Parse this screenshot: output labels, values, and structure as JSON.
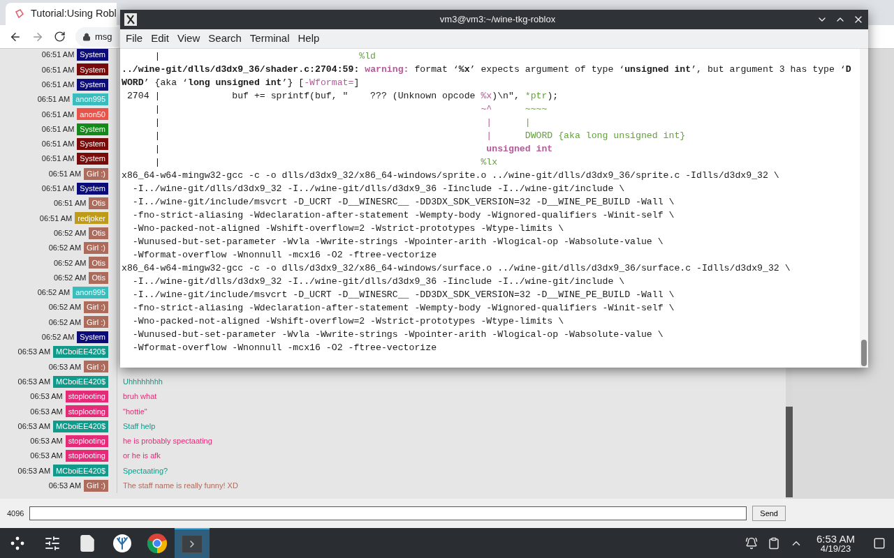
{
  "browser": {
    "tabs": [
      {
        "title": "Tutorial:Using Robl",
        "selected": true
      }
    ],
    "address": "msg"
  },
  "chat": {
    "rows": [
      {
        "time": "06:51 AM",
        "name": "System",
        "color": "#0b0b7a"
      },
      {
        "time": "06:51 AM",
        "name": "System",
        "color": "#7a0b0b"
      },
      {
        "time": "06:51 AM",
        "name": "System",
        "color": "#0b0b7a"
      },
      {
        "time": "06:51 AM",
        "name": "anon995",
        "color": "#3bbdbd"
      },
      {
        "time": "06:51 AM",
        "name": "anon50",
        "color": "#e8534a"
      },
      {
        "time": "06:51 AM",
        "name": "System",
        "color": "#138a1a"
      },
      {
        "time": "06:51 AM",
        "name": "System",
        "color": "#7a0b0b"
      },
      {
        "time": "06:51 AM",
        "name": "System",
        "color": "#7a0b0b"
      },
      {
        "time": "06:51 AM",
        "name": "Girl :)",
        "color": "#ad6b5c"
      },
      {
        "time": "06:51 AM",
        "name": "System",
        "color": "#0b0b7a"
      },
      {
        "time": "06:51 AM",
        "name": "Otis",
        "color": "#ad6b5c"
      },
      {
        "time": "06:51 AM",
        "name": "redjoker",
        "color": "#bf9b1c"
      },
      {
        "time": "06:52 AM",
        "name": "Otis",
        "color": "#ad6b5c"
      },
      {
        "time": "06:52 AM",
        "name": "Girl :)",
        "color": "#ad6b5c"
      },
      {
        "time": "06:52 AM",
        "name": "Otis",
        "color": "#ad6b5c"
      },
      {
        "time": "06:52 AM",
        "name": "Otis",
        "color": "#ad6b5c"
      },
      {
        "time": "06:52 AM",
        "name": "anon995",
        "color": "#3bbdbd"
      },
      {
        "time": "06:52 AM",
        "name": "Girl :)",
        "color": "#ad6b5c"
      },
      {
        "time": "06:52 AM",
        "name": "Girl :)",
        "color": "#ad6b5c"
      },
      {
        "time": "06:52 AM",
        "name": "System",
        "color": "#0b0b7a"
      },
      {
        "time": "06:53 AM",
        "name": "MCboiEE420$",
        "color": "#11998a"
      },
      {
        "time": "06:53 AM",
        "name": "Girl :)",
        "color": "#ad6b5c"
      },
      {
        "time": "06:53 AM",
        "name": "MCboiEE420$",
        "color": "#11998a",
        "message": "Uhhhhhhhh"
      },
      {
        "time": "06:53 AM",
        "name": "stoplooting",
        "color": "#e52a78",
        "message": "bruh what"
      },
      {
        "time": "06:53 AM",
        "name": "stoplooting",
        "color": "#e52a78",
        "message": "\"hottie\""
      },
      {
        "time": "06:53 AM",
        "name": "MCboiEE420$",
        "color": "#11998a",
        "message": "Staff help"
      },
      {
        "time": "06:53 AM",
        "name": "stoplooting",
        "color": "#e52a78",
        "message": "he is probably spectaating"
      },
      {
        "time": "06:53 AM",
        "name": "stoplooting",
        "color": "#e52a78",
        "message": "or he is afk"
      },
      {
        "time": "06:53 AM",
        "name": "MCboiEE420$",
        "color": "#11998a",
        "message": "Spectaating?"
      },
      {
        "time": "06:53 AM",
        "name": "Girl :)",
        "color": "#ad6b5c",
        "message": "The staff name is really funny! XD"
      }
    ],
    "counter": "4096",
    "send": "Send"
  },
  "terminal": {
    "title": "vm3@vm3:~/wine-tkg-roblox",
    "menu": [
      "File",
      "Edit",
      "View",
      "Search",
      "Terminal",
      "Help"
    ],
    "lines": [
      [
        {
          "text": "      |                                    ",
          "kind": "plain"
        },
        {
          "text": "%ld",
          "kind": "green"
        }
      ],
      [
        {
          "text": "../wine-git/dlls/d3dx9_36/shader.c:2704:59: ",
          "kind": "bold"
        },
        {
          "text": "warning:",
          "kind": "magenta_bold"
        },
        {
          "text": " format ‘",
          "kind": "plain"
        },
        {
          "text": "%x",
          "kind": "bold"
        },
        {
          "text": "’ expects argument of type ‘",
          "kind": "plain"
        },
        {
          "text": "unsigned int",
          "kind": "bold"
        },
        {
          "text": "’, but argument 3 has type ‘",
          "kind": "plain"
        },
        {
          "text": "D",
          "kind": "bold"
        }
      ],
      [
        {
          "text": "WORD",
          "kind": "bold"
        },
        {
          "text": "’ {aka ‘",
          "kind": "plain"
        },
        {
          "text": "long unsigned int",
          "kind": "bold"
        },
        {
          "text": "’} [",
          "kind": "plain"
        },
        {
          "text": "-Wformat=",
          "kind": "magenta"
        },
        {
          "text": "]",
          "kind": "plain"
        }
      ],
      [
        {
          "text": " 2704 |             buf += sprintf(buf, \"    ??? (Unknown opcode ",
          "kind": "plain"
        },
        {
          "text": "%x",
          "kind": "magenta"
        },
        {
          "text": ")\\n\", ",
          "kind": "plain"
        },
        {
          "text": "*ptr",
          "kind": "green"
        },
        {
          "text": ");",
          "kind": "plain"
        }
      ],
      [
        {
          "text": "      |                                                          ",
          "kind": "plain"
        },
        {
          "text": "~^",
          "kind": "magenta"
        },
        {
          "text": "      ~~~~",
          "kind": "green"
        }
      ],
      [
        {
          "text": "      |                                                           ",
          "kind": "plain"
        },
        {
          "text": "|",
          "kind": "magenta"
        },
        {
          "text": "      |",
          "kind": "green"
        }
      ],
      [
        {
          "text": "      |                                                           ",
          "kind": "plain"
        },
        {
          "text": "|",
          "kind": "magenta"
        },
        {
          "text": "      DWORD {aka long unsigned int}",
          "kind": "green"
        }
      ],
      [
        {
          "text": "      |                                                           ",
          "kind": "plain"
        },
        {
          "text": "unsigned int",
          "kind": "magenta_bold"
        }
      ],
      [
        {
          "text": "      |                                                          ",
          "kind": "plain"
        },
        {
          "text": "%lx",
          "kind": "green"
        }
      ],
      [
        {
          "text": "x86_64-w64-mingw32-gcc -c -o dlls/d3dx9_32/x86_64-windows/sprite.o ../wine-git/dlls/d3dx9_36/sprite.c -Idlls/d3dx9_32 \\",
          "kind": "plain"
        }
      ],
      [
        {
          "text": "  -I../wine-git/dlls/d3dx9_32 -I../wine-git/dlls/d3dx9_36 -Iinclude -I../wine-git/include \\",
          "kind": "plain"
        }
      ],
      [
        {
          "text": "  -I../wine-git/include/msvcrt -D_UCRT -D__WINESRC__ -DD3DX_SDK_VERSION=32 -D__WINE_PE_BUILD -Wall \\",
          "kind": "plain"
        }
      ],
      [
        {
          "text": "  -fno-strict-aliasing -Wdeclaration-after-statement -Wempty-body -Wignored-qualifiers -Winit-self \\",
          "kind": "plain"
        }
      ],
      [
        {
          "text": "  -Wno-packed-not-aligned -Wshift-overflow=2 -Wstrict-prototypes -Wtype-limits \\",
          "kind": "plain"
        }
      ],
      [
        {
          "text": "  -Wunused-but-set-parameter -Wvla -Wwrite-strings -Wpointer-arith -Wlogical-op -Wabsolute-value \\",
          "kind": "plain"
        }
      ],
      [
        {
          "text": "  -Wformat-overflow -Wnonnull -mcx16 -O2 -ftree-vectorize",
          "kind": "plain"
        }
      ],
      [
        {
          "text": "x86_64-w64-mingw32-gcc -c -o dlls/d3dx9_32/x86_64-windows/surface.o ../wine-git/dlls/d3dx9_36/surface.c -Idlls/d3dx9_32 \\",
          "kind": "plain"
        }
      ],
      [
        {
          "text": "  -I../wine-git/dlls/d3dx9_32 -I../wine-git/dlls/d3dx9_36 -Iinclude -I../wine-git/include \\",
          "kind": "plain"
        }
      ],
      [
        {
          "text": "  -I../wine-git/include/msvcrt -D_UCRT -D__WINESRC__ -DD3DX_SDK_VERSION=32 -D__WINE_PE_BUILD -Wall \\",
          "kind": "plain"
        }
      ],
      [
        {
          "text": "  -fno-strict-aliasing -Wdeclaration-after-statement -Wempty-body -Wignored-qualifiers -Winit-self \\",
          "kind": "plain"
        }
      ],
      [
        {
          "text": "  -Wno-packed-not-aligned -Wshift-overflow=2 -Wstrict-prototypes -Wtype-limits \\",
          "kind": "plain"
        }
      ],
      [
        {
          "text": "  -Wunused-but-set-parameter -Wvla -Wwrite-strings -Wpointer-arith -Wlogical-op -Wabsolute-value \\",
          "kind": "plain"
        }
      ],
      [
        {
          "text": "  -Wformat-overflow -Wnonnull -mcx16 -O2 -ftree-vectorize",
          "kind": "plain"
        }
      ]
    ]
  },
  "taskbar": {
    "apps": [
      {
        "kind": "launcher",
        "selected": false
      },
      {
        "kind": "settings",
        "selected": false
      },
      {
        "kind": "files",
        "selected": false
      },
      {
        "kind": "coral",
        "selected": false
      },
      {
        "kind": "chrome",
        "selected": false
      },
      {
        "kind": "terminal",
        "selected": true
      }
    ],
    "time": "6:53 AM",
    "date": "4/19/23"
  }
}
